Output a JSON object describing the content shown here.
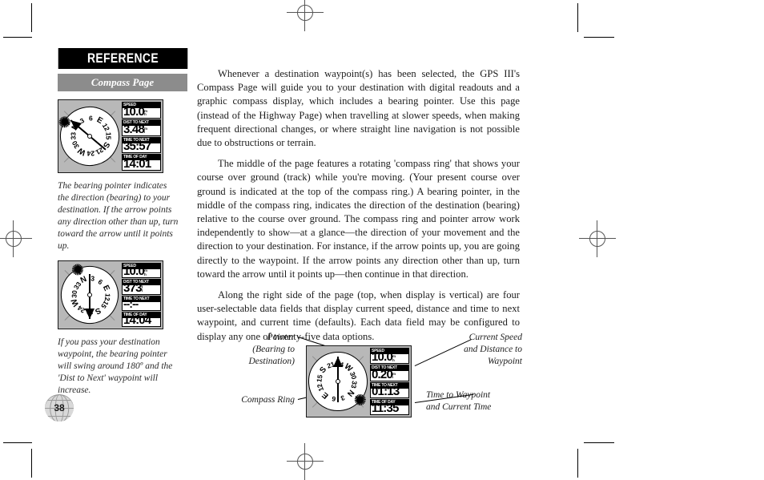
{
  "header": {
    "section_title": "REFERENCE",
    "page_subtitle": "Compass Page",
    "section_bg": "#000000",
    "subtitle_bg": "#8c8c8c"
  },
  "page_number": "38",
  "body": {
    "paragraphs": [
      "Whenever a destination waypoint(s) has been selected, the GPS III's Compass Page will guide you to your destination with digital readouts and a graphic compass display, which includes a bearing pointer. Use this page (instead of the Highway Page) when travelling at slower speeds, when making frequent directional changes, or where straight line navigation is not possible due to obstructions or terrain.",
      "The middle of the page features a rotating 'compass ring' that shows your course over ground (track) while you're moving. (Your present course over ground is indicated at the top of the compass ring.) A bearing pointer, in the middle of the compass ring, indicates the direction of the destination (bearing) relative to the course over ground. The compass ring and pointer arrow work independently to show—at a glance—the direction of your movement and the direction to your destination. For instance, if the arrow points up, you are going directly to the waypoint. If the arrow points any direction other than up, turn toward the arrow until it points up—then continue in that direction.",
      "Along the right side of the page (top, when display is vertical) are four user-selectable data fields that display current speed, distance and time to next waypoint, and current time (defaults). Each data field may be configured to display any one of twenty-five data options."
    ]
  },
  "figures": {
    "top_screen": {
      "caption": "The bearing pointer indicates the direction (bearing) to your destination. If the arrow points any direction other than up, turn toward the arrow until it points up.",
      "fields": [
        {
          "label": "SPEED",
          "value": "10.0",
          "unit_top": "m",
          "unit_bottom": "h"
        },
        {
          "label": "DIST TO NEXT",
          "value": "3.48",
          "unit_top": "m",
          "unit_bottom": "i"
        },
        {
          "label": "TIME TO NEXT",
          "value": "35:57",
          "unit_top": "",
          "unit_bottom": ""
        },
        {
          "label": "TIME OF DAY",
          "value": "14:01",
          "unit_top": "",
          "unit_bottom": ""
        }
      ],
      "compass": {
        "cardinals": [
          "N",
          "E",
          "S",
          "W"
        ],
        "numbers": [
          "3",
          "6",
          "12",
          "15",
          "21",
          "24",
          "30",
          "33"
        ],
        "ring_rotation_deg": -60,
        "pointer_heading_deg": -50
      }
    },
    "middle_screen": {
      "caption": "If you pass your destination waypoint, the bearing pointer will swing around 180º and the 'Dist to Next' waypoint will increase.",
      "fields": [
        {
          "label": "SPEED",
          "value": "10.0",
          "unit_top": "m",
          "unit_bottom": "h"
        },
        {
          "label": "DIST TO NEXT",
          "value": "373",
          "unit_top": "f",
          "unit_bottom": "t"
        },
        {
          "label": "TIME TO NEXT",
          "value": "--:--",
          "unit_top": "",
          "unit_bottom": ""
        },
        {
          "label": "TIME OF DAY",
          "value": "14:04",
          "unit_top": "",
          "unit_bottom": ""
        }
      ],
      "compass": {
        "cardinals": [
          "N",
          "E",
          "S",
          "W"
        ],
        "numbers": [
          "3",
          "6",
          "12",
          "15",
          "21",
          "24",
          "30",
          "33"
        ],
        "ring_rotation_deg": -25,
        "pointer_heading_deg": 180
      }
    },
    "bottom_diagram": {
      "fields": [
        {
          "label": "SPEED",
          "value": "10.0",
          "unit_top": "m",
          "unit_bottom": "h"
        },
        {
          "label": "DIST TO NEXT",
          "value": "0.20",
          "unit_top": "m",
          "unit_bottom": "i"
        },
        {
          "label": "TIME TO NEXT",
          "value": "01:13",
          "unit_top": "",
          "unit_bottom": ""
        },
        {
          "label": "TIME OF DAY",
          "value": "11:35",
          "unit_top": "",
          "unit_bottom": ""
        }
      ],
      "compass": {
        "cardinals": [
          "N",
          "E",
          "S",
          "W"
        ],
        "numbers": [
          "3",
          "6",
          "12",
          "15",
          "21",
          "24",
          "30",
          "33"
        ],
        "ring_rotation_deg": 130,
        "pointer_heading_deg": 0
      },
      "annotations": {
        "pointer": "Pointer\n(Bearing to\nDestination)",
        "pointer_line1": "Pointer",
        "pointer_line2": "(Bearing to",
        "pointer_line3": "Destination)",
        "compass_ring": "Compass Ring",
        "speed_distance_line1": "Current Speed",
        "speed_distance_line2": "and Distance to",
        "speed_distance_line3": "Waypoint",
        "time_line1": "Time to Waypoint",
        "time_line2": "and Current Time"
      }
    }
  }
}
